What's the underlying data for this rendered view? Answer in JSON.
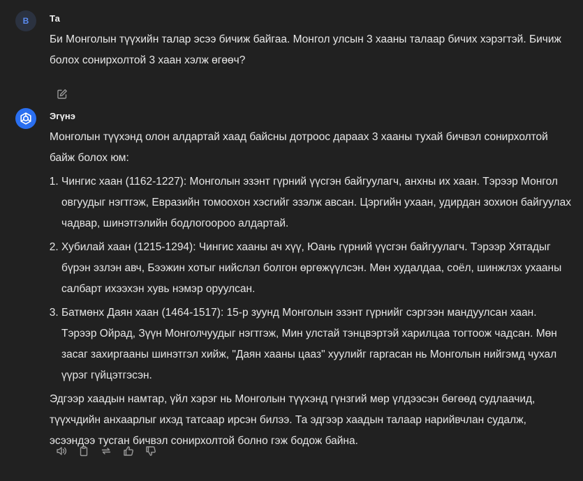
{
  "user_message": {
    "avatar_letter": "B",
    "sender": "Та",
    "text": "Би Монголын түүхийн талар эсээ бичиж байгаа. Монгол улсын 3 хааны талаар бичих хэрэгтэй. Бичиж болох сонирхолтой 3 хаан хэлж өгөөч?",
    "edit_icon": "edit-icon"
  },
  "bot_message": {
    "avatar_icon": "assistant-logo-icon",
    "sender": "Эгүнэ",
    "intro": "Монголын түүхэнд олон алдартай хаад байсны дотроос дараах 3 хааны тухай бичвэл сонирхолтой байж болох юм:",
    "items": [
      {
        "text": "Чингис хаан (1162-1227): Монголын эзэнт гүрний үүсгэн байгуулагч, анхны их хаан. Тэрээр Монгол овгуудыг нэгтгэж, Евразийн томоохон хэсгийг эзэлж авсан. Цэргийн ухаан, удирдан зохион байгуулах чадвар, шинэтгэлийн бодлогоороо алдартай."
      },
      {
        "text": "Хубилай хаан (1215-1294): Чингис хааны ач хүү, Юань гүрний үүсгэн байгуулагч. Тэрээр Хятадыг бүрэн эзлэн авч, Бээжин хотыг нийслэл болгон өргөжүүлсэн. Мөн худалдаа, соёл, шинжлэх ухааны салбарт ихээхэн хувь нэмэр оруулсан."
      },
      {
        "text": "Батмөнх Даян хаан (1464-1517): 15-р зуунд Монголын эзэнт гүрнийг сэргээн мандуулсан хаан. Тэрээр Ойрад, Зүүн Монголчуудыг нэгтгэж, Мин улстай тэнцвэртэй харилцаа тогтоож чадсан. Мөн засаг захиргааны шинэтгэл хийж, \"Даян хааны цааз\" хуулийг гаргасан нь Монголын нийгэмд чухал үүрэг гүйцэтгэсэн."
      }
    ],
    "outro": "Эдгээр хаадын намтар, үйл хэрэг нь Монголын түүхэнд гүнзгий мөр үлдээсэн бөгөөд судлаачид, түүхчдийн анхаарлыг ихэд татсаар ирсэн билээ. Та эдгээр хаадын талаар нарийвчлан судалж, эсээндээ тусган бичвэл сонирхолтой болно гэж бодож байна.",
    "actions": [
      "speaker-icon",
      "copy-icon",
      "regenerate-icon",
      "thumbs-up-icon",
      "thumbs-down-icon"
    ]
  },
  "colors": {
    "background": "#212121",
    "text": "#e8e8e8",
    "icon": "#9a9a9a",
    "accent": "#2a6ff0"
  }
}
